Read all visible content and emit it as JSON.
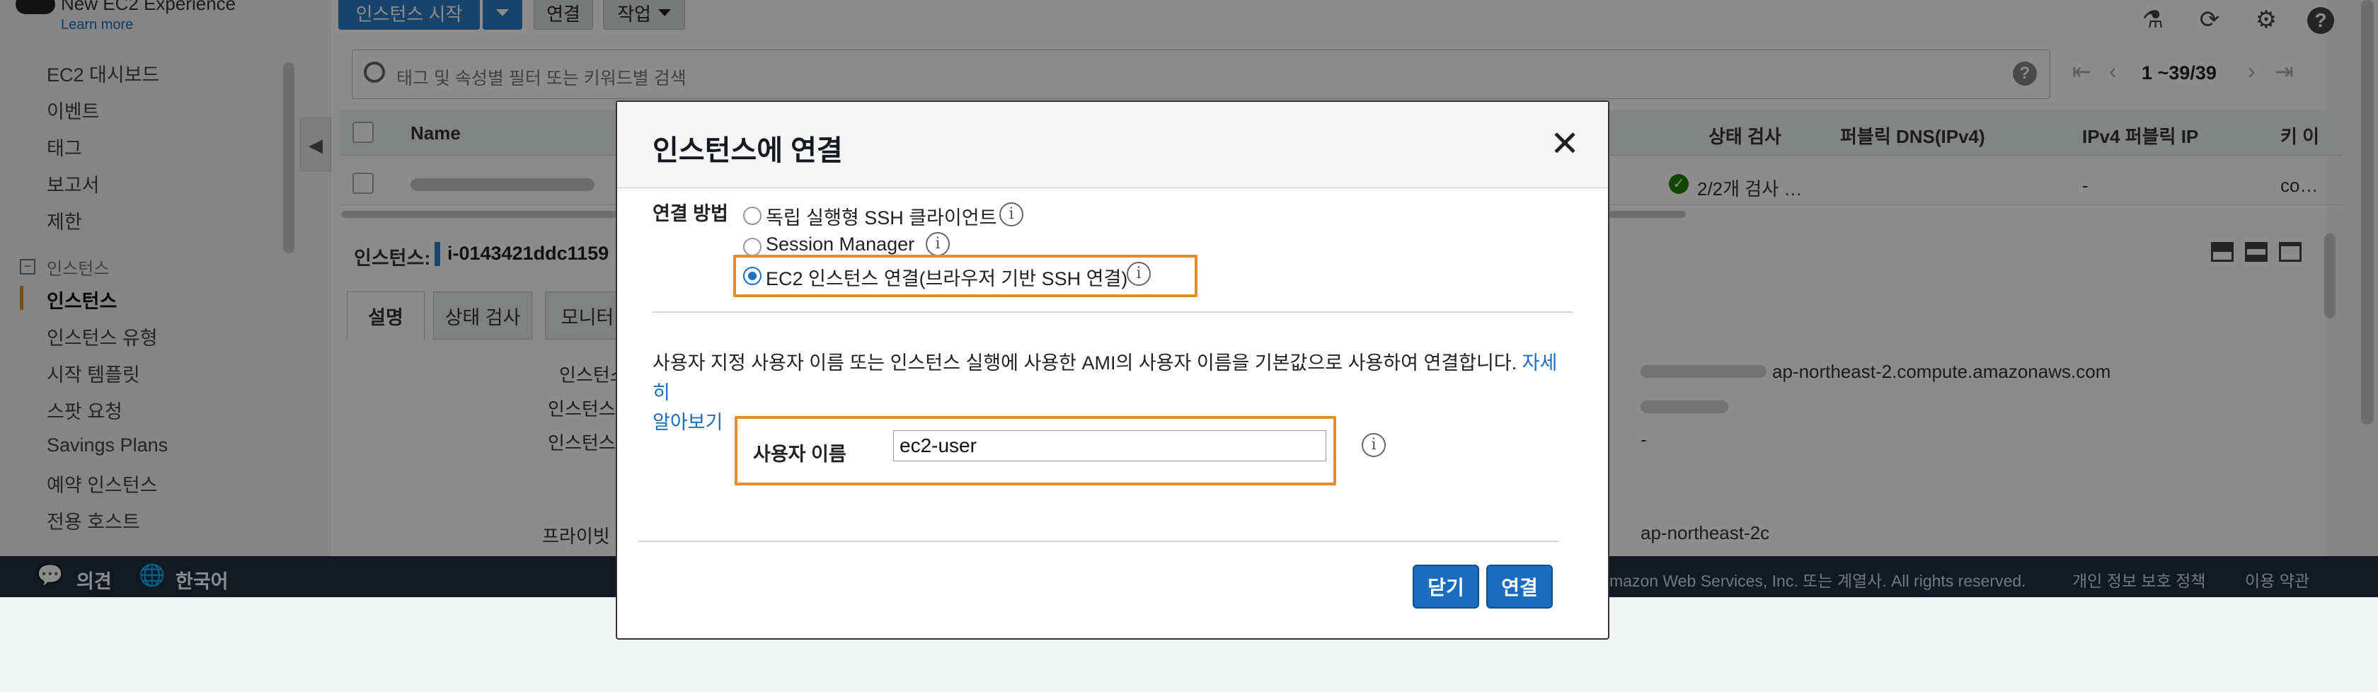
{
  "header": {
    "experience_title": "New EC2 Experience",
    "learn_more": "Learn more",
    "launch_button": "인스턴스 시작",
    "connect_button": "연결",
    "actions_button": "작업"
  },
  "sidebar": {
    "items": [
      {
        "label": "EC2 대시보드"
      },
      {
        "label": "이벤트"
      },
      {
        "label": "태그"
      },
      {
        "label": "보고서"
      },
      {
        "label": "제한"
      }
    ],
    "section_label": "인스턴스",
    "section_items": [
      {
        "label": "인스턴스",
        "active": true
      },
      {
        "label": "인스턴스 유형"
      },
      {
        "label": "시작 템플릿"
      },
      {
        "label": "스팟 요청"
      },
      {
        "label": "Savings Plans"
      },
      {
        "label": "예약 인스턴스"
      },
      {
        "label": "전용 호스트"
      }
    ]
  },
  "search": {
    "placeholder": "태그 및 속성별 필터 또는 키워드별 검색",
    "pagination": "1 ~39/39"
  },
  "table": {
    "columns": [
      "Name",
      "상태 검사",
      "퍼블릭 DNS(IPv4)",
      "IPv4 퍼블릭 IP",
      "키 이"
    ],
    "row1": {
      "status": "2/2개 검사 …",
      "dns": "",
      "ip": "-",
      "key": "co…"
    }
  },
  "details": {
    "instance_label": "인스턴스:",
    "instance_id": "i-0143421ddc1159",
    "tabs": [
      "설명",
      "상태 검사",
      "모니터"
    ],
    "keys": [
      "인스턴스",
      "인스턴스",
      "인스턴스",
      "프라이빗 I"
    ],
    "values": [
      "ap-northeast-2.compute.amazonaws.com",
      "-",
      "ap-northeast-2c"
    ]
  },
  "footer": {
    "feedback": "의견",
    "language": "한국어",
    "copyright": "mazon Web Services, Inc. 또는 계열사. All rights reserved.",
    "privacy": "개인 정보 보호 정책",
    "terms": "이용 약관"
  },
  "modal": {
    "title": "인스턴스에 연결",
    "method_label": "연결 방법",
    "options": [
      {
        "label": "독립 실행형 SSH 클라이언트",
        "selected": false
      },
      {
        "label": "Session Manager",
        "selected": false
      },
      {
        "label": "EC2 인스턴스 연결(브라우저 기반 SSH 연결)",
        "selected": true
      }
    ],
    "description": "사용자 지정 사용자 이름 또는 인스턴스 실행에 사용한 AMI의 사용자 이름을 기본값으로 사용하여 연결합니다.",
    "learn_more_1": "자세히",
    "learn_more_2": "알아보기",
    "username_label": "사용자 이름",
    "username_value": "ec2-user",
    "close_button": "닫기",
    "connect_button": "연결"
  },
  "colors": {
    "accent": "#1a6cc0",
    "highlight": "#e58b2a",
    "footer_bg": "#222f3e"
  }
}
